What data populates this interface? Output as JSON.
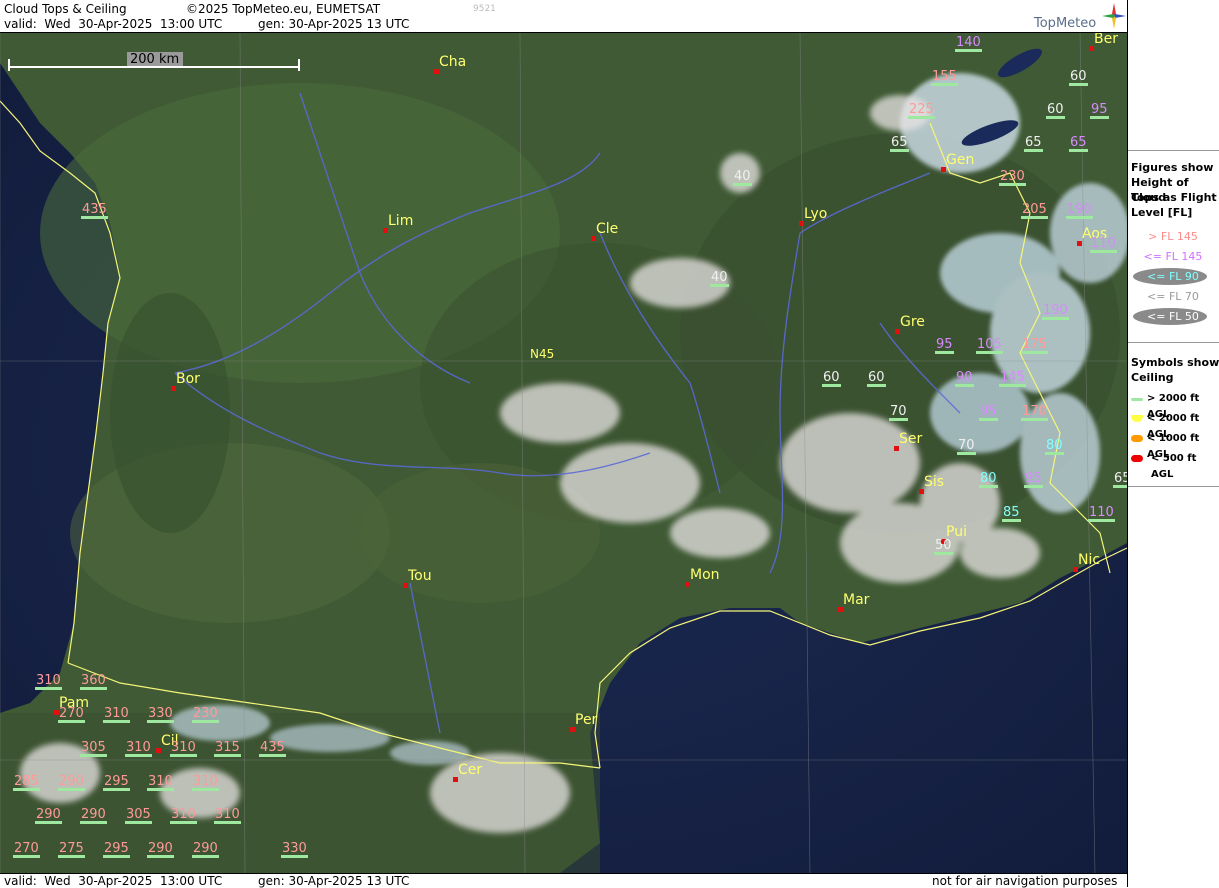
{
  "header": {
    "title": "Cloud Tops & Ceiling",
    "copyright": "©2025 TopMeteo.eu, EUMETSAT",
    "code": "9521",
    "valid": "valid:  Wed  30-Apr-2025  13:00 UTC",
    "gen": "gen: 30-Apr-2025 13 UTC",
    "logo": "TopMeteo"
  },
  "footer": {
    "valid": "valid:  Wed  30-Apr-2025  13:00 UTC",
    "gen": "gen: 30-Apr-2025 13 UTC",
    "disclaimer": "not for air navigation purposes"
  },
  "scale": {
    "label": "200 km"
  },
  "graticule": {
    "label": "N45"
  },
  "legend": {
    "title_lines": [
      "Figures show",
      "Height of Cloud",
      "Tops as Flight",
      "Level  [FL]"
    ],
    "items": [
      {
        "label": "> FL 145",
        "color": "#ff8a8a"
      },
      {
        "label": "<= FL 145",
        "color": "#d070ff"
      },
      {
        "label": "<= FL 90",
        "color": "#80ffff"
      },
      {
        "label": "<= FL 70",
        "color": "#9a9a9a"
      },
      {
        "label": "<= FL 50",
        "color": "#ffffff"
      }
    ],
    "symbols_title_lines": [
      "Symbols show",
      "Ceiling"
    ],
    "symbols": [
      {
        "label": "> 2000 ft AGL",
        "color": "#9fe89f"
      },
      {
        "label": "< 2000 ft AGL",
        "color": "#ffff40"
      },
      {
        "label": "< 1000 ft AGL",
        "color": "#ff9a00"
      },
      {
        "label": "< 500 ft AGL",
        "color": "#ee0000"
      }
    ]
  },
  "cities": [
    "Cha",
    "Ber",
    "Gen",
    "Lim",
    "Cle",
    "Lyo",
    "Aos",
    "Gre",
    "Bor",
    "Ser",
    "Sis",
    "Pui",
    "Tou",
    "Mon",
    "Mar",
    "Nic",
    "Pam",
    "Cil",
    "Per",
    "Cer"
  ],
  "flight_levels": [
    "140",
    "155",
    "225",
    "60",
    "60",
    "95",
    "65",
    "65",
    "65",
    "40",
    "435",
    "230",
    "205",
    "190",
    "110",
    "40",
    "190",
    "95",
    "105",
    "175",
    "145",
    "60",
    "60",
    "90",
    "95",
    "170",
    "70",
    "70",
    "80",
    "80",
    "95",
    "65",
    "85",
    "110",
    "50",
    "310",
    "360",
    "270",
    "310",
    "330",
    "230",
    "305",
    "310",
    "310",
    "315",
    "435",
    "285",
    "290",
    "295",
    "310",
    "310",
    "290",
    "290",
    "305",
    "310",
    "310",
    "270",
    "275",
    "295",
    "290",
    "290",
    "330"
  ]
}
